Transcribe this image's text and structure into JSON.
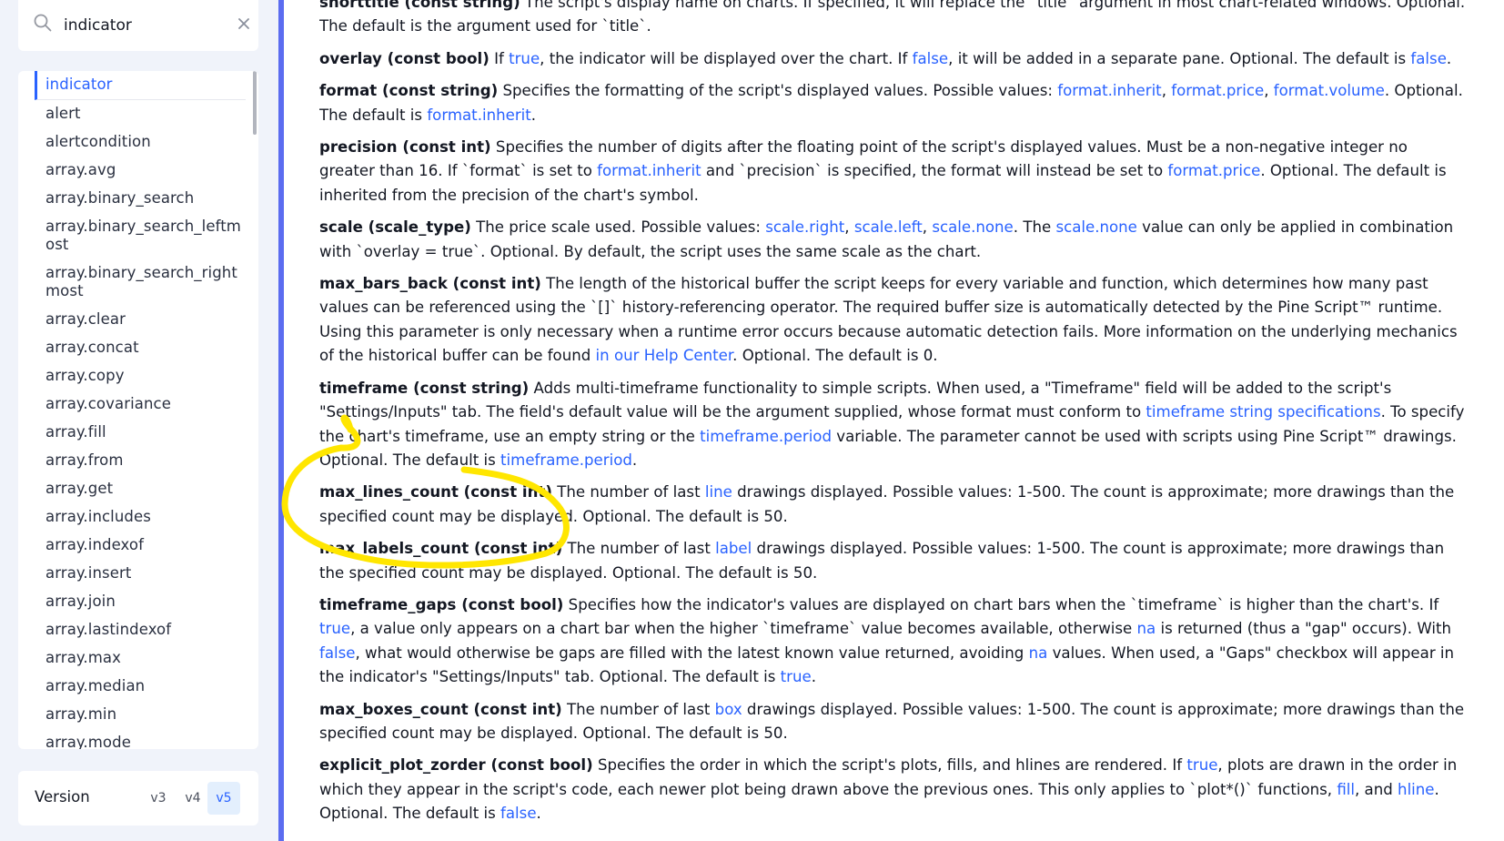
{
  "search": {
    "value": "indicator",
    "placeholder": ""
  },
  "sidebar": {
    "items": [
      {
        "label": "indicator"
      },
      {
        "label": "alert"
      },
      {
        "label": "alertcondition"
      },
      {
        "label": "array.avg"
      },
      {
        "label": "array.binary_search"
      },
      {
        "label": "array.binary_search_leftm\nost"
      },
      {
        "label": "array.binary_search_right\nmost"
      },
      {
        "label": "array.clear"
      },
      {
        "label": "array.concat"
      },
      {
        "label": "array.copy"
      },
      {
        "label": "array.covariance"
      },
      {
        "label": "array.fill"
      },
      {
        "label": "array.from"
      },
      {
        "label": "array.get"
      },
      {
        "label": "array.includes"
      },
      {
        "label": "array.indexof"
      },
      {
        "label": "array.insert"
      },
      {
        "label": "array.join"
      },
      {
        "label": "array.lastindexof"
      },
      {
        "label": "array.max"
      },
      {
        "label": "array.median"
      },
      {
        "label": "array.min"
      },
      {
        "label": "array.mode"
      }
    ]
  },
  "version": {
    "label": "Version",
    "options": [
      "v3",
      "v4",
      "v5"
    ],
    "selected": "v5"
  },
  "colors": {
    "link": "#2962ff",
    "accent_bar": "#5b6cf0",
    "highlighter": "#ffe600",
    "sidebar_bg": "#f0f3fa"
  },
  "params": [
    {
      "name": "shorttitle (const string)",
      "parts": [
        {
          "t": " The script's display name on charts. If specified, it will replace the `title` argument in most chart-related windows. Optional. The default is the argument used for `title`."
        }
      ]
    },
    {
      "name": "overlay (const bool)",
      "parts": [
        {
          "t": " If "
        },
        {
          "t": "true",
          "link": true
        },
        {
          "t": ", the indicator will be displayed over the chart. If "
        },
        {
          "t": "false",
          "link": true
        },
        {
          "t": ", it will be added in a separate pane. Optional. The default is "
        },
        {
          "t": "false",
          "link": true
        },
        {
          "t": "."
        }
      ]
    },
    {
      "name": "format (const string)",
      "parts": [
        {
          "t": " Specifies the formatting of the script's displayed values. Possible values: "
        },
        {
          "t": "format.inherit",
          "link": true
        },
        {
          "t": ", "
        },
        {
          "t": "format.price",
          "link": true
        },
        {
          "t": ", "
        },
        {
          "t": "format.volume",
          "link": true
        },
        {
          "t": ". Optional. The default is "
        },
        {
          "t": "format.inherit",
          "link": true
        },
        {
          "t": "."
        }
      ]
    },
    {
      "name": "precision (const int)",
      "parts": [
        {
          "t": " Specifies the number of digits after the floating point of the script's displayed values. Must be a non-negative integer no greater than 16. If `format` is set to "
        },
        {
          "t": "format.inherit",
          "link": true
        },
        {
          "t": " and `precision` is specified, the format will instead be set to "
        },
        {
          "t": "format.price",
          "link": true
        },
        {
          "t": ". Optional. The default is inherited from the precision of the chart's symbol."
        }
      ]
    },
    {
      "name": "scale (scale_type)",
      "parts": [
        {
          "t": " The price scale used. Possible values: "
        },
        {
          "t": "scale.right",
          "link": true
        },
        {
          "t": ", "
        },
        {
          "t": "scale.left",
          "link": true
        },
        {
          "t": ", "
        },
        {
          "t": "scale.none",
          "link": true
        },
        {
          "t": ". The "
        },
        {
          "t": "scale.none",
          "link": true
        },
        {
          "t": " value can only be applied in combination with `overlay = true`. Optional. By default, the script uses the same scale as the chart."
        }
      ]
    },
    {
      "name": "max_bars_back (const int)",
      "parts": [
        {
          "t": " The length of the historical buffer the script keeps for every variable and function, which determines how many past values can be referenced using the `[]` history-referencing operator. The required buffer size is automatically detected by the Pine Script™ runtime. Using this parameter is only necessary when a runtime error occurs because automatic detection fails. More information on the underlying mechanics of the historical buffer can be found "
        },
        {
          "t": "in our Help Center",
          "link": true
        },
        {
          "t": ". Optional. The default is 0."
        }
      ]
    },
    {
      "name": "timeframe (const string)",
      "parts": [
        {
          "t": " Adds multi-timeframe functionality to simple scripts. When used, a \"Timeframe\" field will be added to the script's \"Settings/Inputs\" tab. The field's default value will be the argument supplied, whose format must conform to "
        },
        {
          "t": "timeframe string specifications",
          "link": true
        },
        {
          "t": ". To specify the chart's timeframe, use an empty string or the "
        },
        {
          "t": "timeframe.period",
          "link": true
        },
        {
          "t": " variable. The parameter cannot be used with scripts using Pine Script™ drawings. Optional. The default is "
        },
        {
          "t": "timeframe.period",
          "link": true
        },
        {
          "t": "."
        }
      ]
    },
    {
      "name": "max_lines_count (const int)",
      "parts": [
        {
          "t": " The number of last "
        },
        {
          "t": "line",
          "link": true
        },
        {
          "t": " drawings displayed. Possible values: 1-500. The count is approximate; more drawings than the specified count may be displayed. Optional. The default is 50."
        }
      ]
    },
    {
      "name": "max_labels_count (const int)",
      "parts": [
        {
          "t": " The number of last "
        },
        {
          "t": "label",
          "link": true
        },
        {
          "t": " drawings displayed. Possible values: 1-500. The count is approximate; more drawings than the specified count may be displayed. Optional. The default is 50."
        }
      ]
    },
    {
      "name": "timeframe_gaps (const bool)",
      "parts": [
        {
          "t": " Specifies how the indicator's values are displayed on chart bars when the `timeframe` is higher than the chart's. If "
        },
        {
          "t": "true",
          "link": true
        },
        {
          "t": ", a value only appears on a chart bar when the higher `timeframe` value becomes available, otherwise "
        },
        {
          "t": "na",
          "link": true
        },
        {
          "t": " is returned (thus a \"gap\" occurs). With "
        },
        {
          "t": "false",
          "link": true
        },
        {
          "t": ", what would otherwise be gaps are filled with the latest known value returned, avoiding "
        },
        {
          "t": "na",
          "link": true
        },
        {
          "t": " values. When used, a \"Gaps\" checkbox will appear in the indicator's \"Settings/Inputs\" tab. Optional. The default is "
        },
        {
          "t": "true",
          "link": true
        },
        {
          "t": "."
        }
      ]
    },
    {
      "name": "max_boxes_count (const int)",
      "parts": [
        {
          "t": " The number of last "
        },
        {
          "t": "box",
          "link": true
        },
        {
          "t": " drawings displayed. Possible values: 1-500. The count is approximate; more drawings than the specified count may be displayed. Optional. The default is 50."
        }
      ]
    },
    {
      "name": "explicit_plot_zorder (const bool)",
      "parts": [
        {
          "t": " Specifies the order in which the script's plots, fills, and hlines are rendered. If "
        },
        {
          "t": "true",
          "link": true
        },
        {
          "t": ", plots are drawn in the order in which they appear in the script's code, each newer plot being drawn above the previous ones. This only applies to `plot*()` functions, "
        },
        {
          "t": "fill",
          "link": true
        },
        {
          "t": ", and "
        },
        {
          "t": "hline",
          "link": true
        },
        {
          "t": ". Optional. The default is "
        },
        {
          "t": "false",
          "link": true
        },
        {
          "t": "."
        }
      ]
    }
  ]
}
